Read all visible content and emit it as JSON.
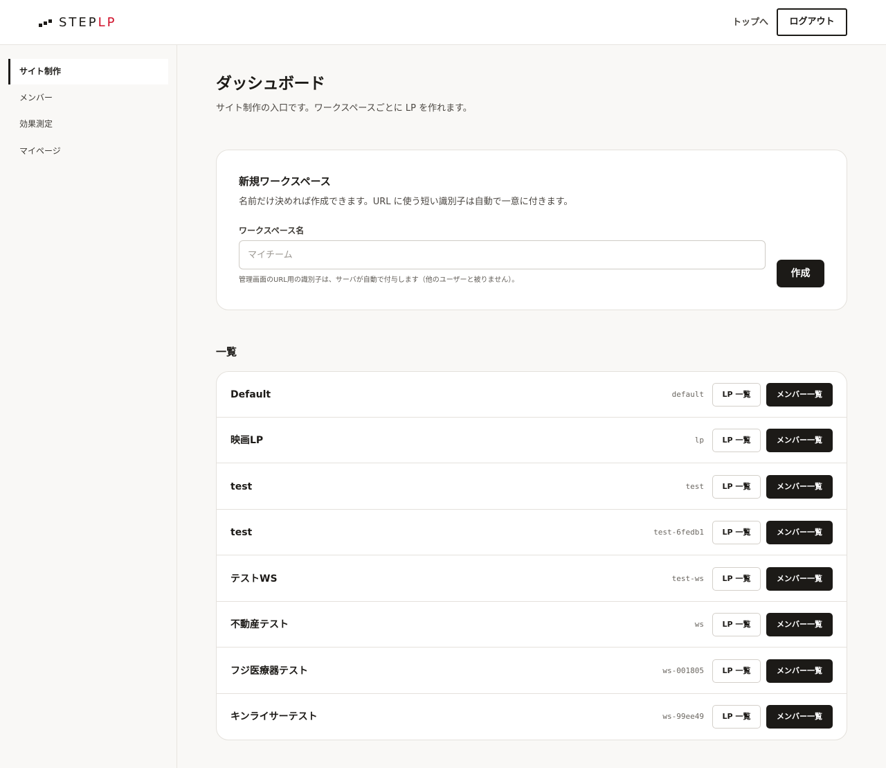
{
  "header": {
    "logo_main": "STEP",
    "logo_accent": "LP",
    "top_link": "トップへ",
    "logout_label": "ログアウト"
  },
  "sidebar": {
    "items": [
      {
        "label": "サイト制作",
        "active": true
      },
      {
        "label": "メンバー",
        "active": false
      },
      {
        "label": "効果測定",
        "active": false
      },
      {
        "label": "マイページ",
        "active": false
      }
    ]
  },
  "main": {
    "title": "ダッシュボード",
    "description": "サイト制作の入口です。ワークスペースごとに LP を作れます。"
  },
  "new_workspace": {
    "title": "新規ワークスペース",
    "description": "名前だけ決めれば作成できます。URL に使う短い識別子は自動で一意に付きます。",
    "field_label": "ワークスペース名",
    "input_value": "",
    "input_placeholder": "マイチーム",
    "hint": "管理画面のURL用の識別子は、サーバが自動で付与します（他のユーザーと被りません）。",
    "create_label": "作成"
  },
  "list": {
    "title": "一覧",
    "lp_button_label": "LP 一覧",
    "member_button_label": "メンバー一覧",
    "workspaces": [
      {
        "name": "Default",
        "slug": "default"
      },
      {
        "name": "映画LP",
        "slug": "lp"
      },
      {
        "name": "test",
        "slug": "test"
      },
      {
        "name": "test",
        "slug": "test-6fedb1"
      },
      {
        "name": "テストWS",
        "slug": "test-ws"
      },
      {
        "name": "不動産テスト",
        "slug": "ws"
      },
      {
        "name": "フジ医療器テスト",
        "slug": "ws-001805"
      },
      {
        "name": "キンライサーテスト",
        "slug": "ws-99ee49"
      }
    ]
  },
  "colors": {
    "accent": "#d0112b",
    "dark": "#1c1a17",
    "background": "#f9f8f6"
  }
}
